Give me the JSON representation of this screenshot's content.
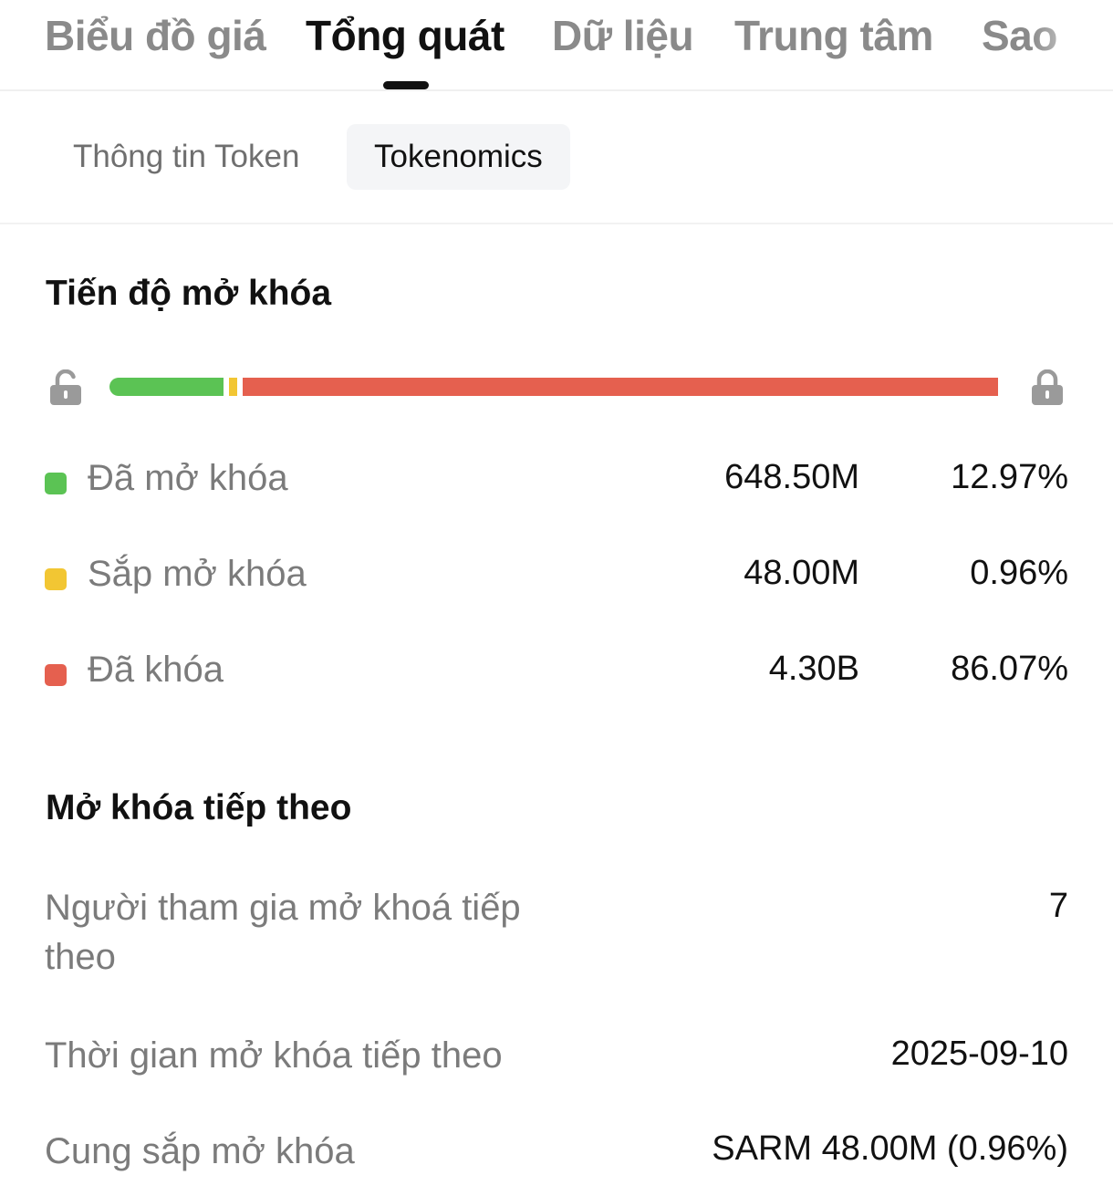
{
  "top_tabs": [
    {
      "label": "Biểu đồ giá"
    },
    {
      "label": "Tổng quát"
    },
    {
      "label": "Dữ liệu"
    },
    {
      "label": "Trung tâm"
    },
    {
      "label": "Sao"
    }
  ],
  "active_top_tab": "Tổng quát",
  "sub_tabs": [
    {
      "label": "Thông tin Token"
    },
    {
      "label": "Tokenomics"
    }
  ],
  "active_sub_tab": "Tokenomics",
  "unlock_progress": {
    "title": "Tiến độ mở khóa",
    "segments": [
      {
        "label": "Đã mở khóa",
        "amount": "648.50M",
        "percent": "12.97%",
        "fraction": 0.1297,
        "color": "#5bc354"
      },
      {
        "label": "Sắp mở khóa",
        "amount": "48.00M",
        "percent": "0.96%",
        "fraction": 0.0096,
        "color": "#f2c633"
      },
      {
        "label": "Đã khóa",
        "amount": "4.30B",
        "percent": "86.07%",
        "fraction": 0.8607,
        "color": "#e5604f"
      }
    ],
    "start_icon": "unlock-icon",
    "end_icon": "lock-icon"
  },
  "next_unlock": {
    "title": "Mở khóa tiếp theo",
    "rows": [
      {
        "label": "Người tham gia mở khoá tiếp theo",
        "value": "7"
      },
      {
        "label": "Thời gian mở khóa tiếp theo",
        "value": "2025-09-10"
      },
      {
        "label": "Cung sắp mở khóa",
        "value": "SARM 48.00M (0.96%)"
      }
    ]
  }
}
